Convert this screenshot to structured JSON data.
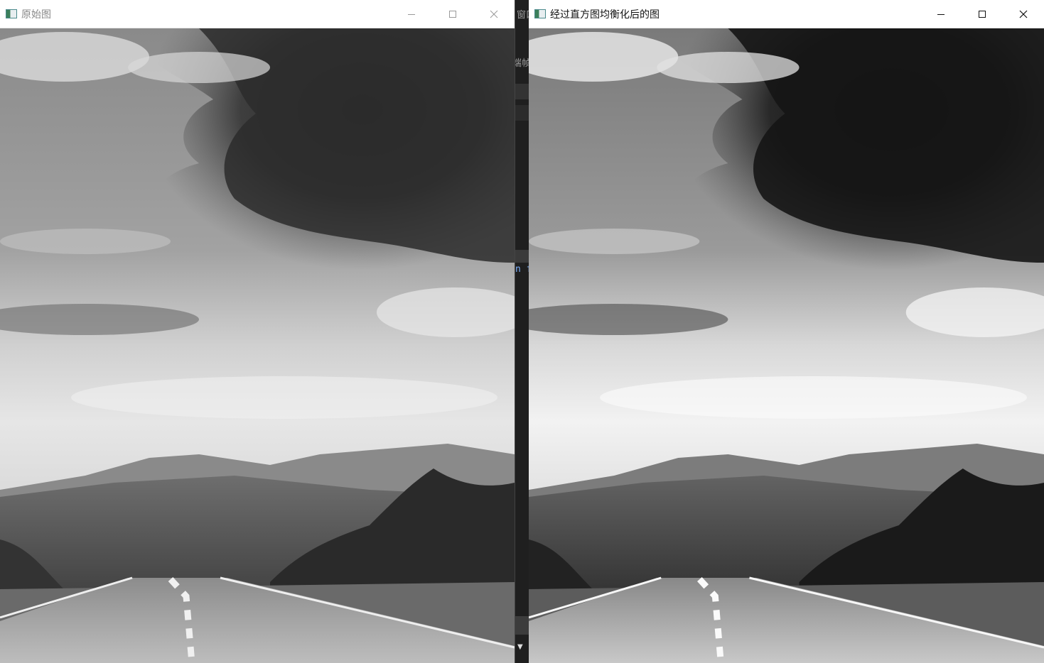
{
  "windows": [
    {
      "title": "原始图",
      "focused": false
    },
    {
      "title": "经过直方图均衡化后的图",
      "focused": true
    }
  ],
  "background_fragments": {
    "top_glyph": "窗口",
    "side_glyph": "端帧",
    "code_fragment": "n f"
  },
  "icons": {
    "app": "opencv-window-icon",
    "minimize": "minimize-icon",
    "maximize": "maximize-icon",
    "close": "close-icon",
    "scroll_down": "scroll-down-arrow-icon"
  }
}
